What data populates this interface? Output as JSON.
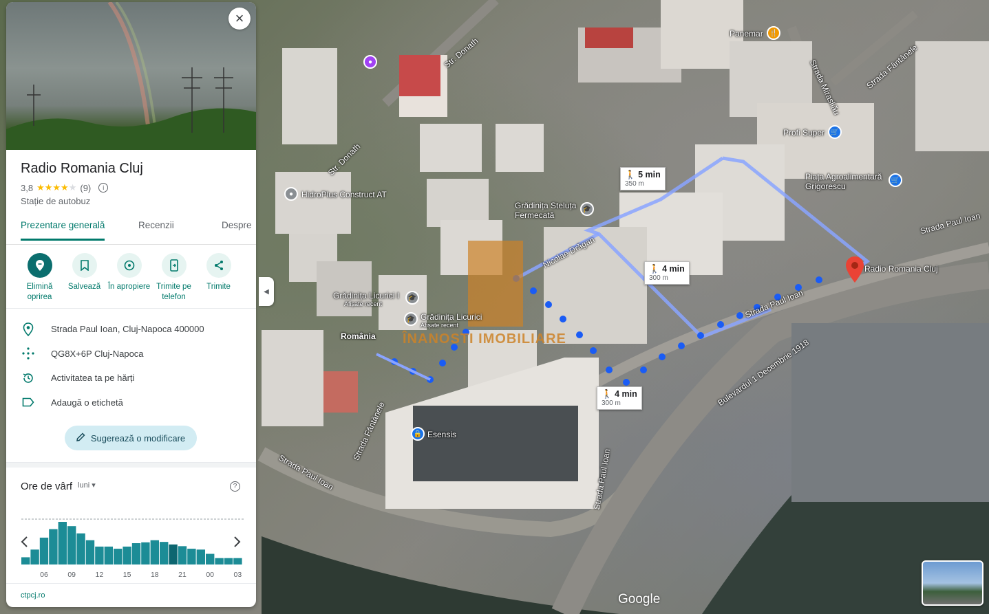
{
  "panel": {
    "close_label": "×",
    "title": "Radio Romania Cluj",
    "rating": "3,8",
    "stars_filled": 4,
    "review_count": "(9)",
    "category": "Stație de autobuz",
    "tabs": [
      "Prezentare generală",
      "Recenzii",
      "Despre"
    ],
    "actions": [
      {
        "label": "Elimină oprirea",
        "icon": "pin-remove-icon"
      },
      {
        "label": "Salvează",
        "icon": "bookmark-icon"
      },
      {
        "label": "În apropiere",
        "icon": "nearby-icon"
      },
      {
        "label": "Trimite pe telefon",
        "icon": "send-to-phone-icon"
      },
      {
        "label": "Trimite",
        "icon": "share-icon"
      }
    ],
    "info_rows": [
      {
        "text": "Strada Paul Ioan, Cluj-Napoca 400000",
        "icon": "location-pin-icon"
      },
      {
        "text": "QG8X+6P Cluj-Napoca",
        "icon": "plus-code-icon"
      },
      {
        "text": "Activitatea ta pe hărți",
        "icon": "history-icon"
      },
      {
        "text": "Adaugă o etichetă",
        "icon": "label-icon"
      }
    ],
    "suggest_label": "Sugerează o modificare",
    "peak": {
      "title": "Ore de vârf",
      "day": "luni"
    },
    "website": "ctpcj.ro"
  },
  "chart_data": {
    "type": "bar",
    "title": "Ore de vârf",
    "categories": [
      "04",
      "05",
      "06",
      "07",
      "08",
      "09",
      "10",
      "11",
      "12",
      "13",
      "14",
      "15",
      "16",
      "17",
      "18",
      "19",
      "20",
      "21",
      "22",
      "23",
      "00",
      "01",
      "02",
      "03"
    ],
    "values": [
      17,
      35,
      63,
      83,
      100,
      90,
      73,
      57,
      42,
      42,
      37,
      42,
      50,
      52,
      57,
      53,
      47,
      43,
      37,
      35,
      25,
      15,
      15,
      15
    ],
    "highlight_index": 16,
    "tick_labels": [
      "06",
      "09",
      "12",
      "15",
      "18",
      "21",
      "00",
      "03"
    ],
    "ylim": [
      0,
      100
    ],
    "grid": false,
    "color": "#1c8c96",
    "highlight_color": "#0d6670"
  },
  "map": {
    "labels": [
      "Str. Donath",
      "Str. Donath",
      "Strada Mirasliău",
      "Strada Fântânele",
      "Strada Paul Ioan",
      "Strada Paul Ioan",
      "Strada Paul Ioan",
      "Bulevardul 1 Decembrie 1918",
      "Strada Fântânele",
      "Strada Paul Ioan",
      "Nicolae Drăgan"
    ],
    "pois": [
      {
        "name": "Panemar",
        "color": "#f29900"
      },
      {
        "name": "Profi Super",
        "color": "#1a73e8"
      },
      {
        "name": "Piața Agroalimentară Grigorescu",
        "color": "#1a73e8"
      },
      {
        "name": "HidroPlus Construct AT",
        "color": "#5f6368"
      },
      {
        "name": "Grădinița Steluța Fermecată",
        "color": "#5f6368"
      },
      {
        "name": "Grădinița Licurici I",
        "sub": "Afișate recent",
        "color": "#5f6368"
      },
      {
        "name": "Grădinița Licurici",
        "sub": "Afișate recent",
        "color": "#5f6368"
      },
      {
        "name": "Esensis",
        "color": "#1a73e8"
      },
      {
        "name": "România",
        "color": "#202124"
      },
      {
        "name": "Radio Romania Cluj",
        "color": "#ea4335"
      }
    ],
    "walks": [
      {
        "time": "5 min",
        "dist": "350 m"
      },
      {
        "time": "4 min",
        "dist": "300 m"
      },
      {
        "time": "4 min",
        "dist": "300 m"
      }
    ],
    "watermark": "ÎNANOSTI IMOBILIARE",
    "logo": "Google",
    "collapse_icon": "◀"
  }
}
